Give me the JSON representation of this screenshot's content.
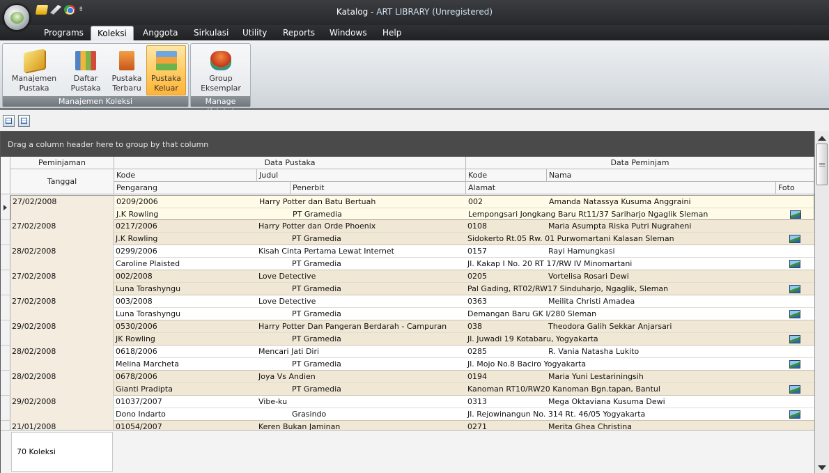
{
  "window": {
    "title_prefix": "Katalog - ",
    "title_app": "ART LIBRARY (Unregistered)"
  },
  "menu": [
    "Programs",
    "Koleksi",
    "Anggota",
    "Sirkulasi",
    "Utility",
    "Reports",
    "Windows",
    "Help"
  ],
  "ribbon": {
    "group1": {
      "label": "Manajemen Koleksi",
      "buttons": [
        {
          "line1": "Manajemen",
          "line2": "Pustaka"
        },
        {
          "line1": "Daftar",
          "line2": "Pustaka"
        },
        {
          "line1": "Pustaka",
          "line2": "Terbaru"
        },
        {
          "line1": "Pustaka",
          "line2": "Keluar"
        }
      ]
    },
    "group2": {
      "label": "Manage Koleksi",
      "buttons": [
        {
          "line1": "Group",
          "line2": "Eksemplar"
        }
      ]
    }
  },
  "grid": {
    "group_hint": "Drag a column header here to group by that column",
    "bands": {
      "peminjaman": "Peminjaman",
      "data_pustaka": "Data Pustaka",
      "data_peminjam": "Data Peminjam"
    },
    "columns": {
      "tanggal": "Tanggal",
      "kode": "Kode",
      "judul": "Judul",
      "pengarang": "Pengarang",
      "penerbit": "Penerbit",
      "kode2": "Kode",
      "nama": "Nama",
      "alamat": "Alamat",
      "foto": "Foto"
    },
    "rows": [
      {
        "tanggal": "27/02/2008",
        "kode": "0209/2006",
        "judul": "Harry Potter dan Batu Bertuah",
        "kode2": "002",
        "nama": "Amanda Natassya Kusuma Anggraini",
        "pengarang": "J.K Rowling",
        "penerbit": "PT Gramedia",
        "alamat": "Lempongsari Jongkang Baru Rt11/37 Sariharjo Ngaglik Sleman"
      },
      {
        "tanggal": "27/02/2008",
        "kode": "0217/2006",
        "judul": "Harry Potter dan Orde Phoenix",
        "kode2": "0108",
        "nama": "Maria Asumpta Riska Putri Nugraheni",
        "pengarang": "J.K Rowling",
        "penerbit": "PT Gramedia",
        "alamat": "Sidokerto Rt.05 Rw. 01 Purwomartani Kalasan Sleman"
      },
      {
        "tanggal": "28/02/2008",
        "kode": "0299/2006",
        "judul": "Kisah Cinta Pertama Lewat Internet",
        "kode2": "0157",
        "nama": "Rayi Hamungkasi",
        "pengarang": "Caroline Plaisted",
        "penerbit": "PT Gramedia",
        "alamat": "Jl. Kakap I No. 20 RT 17/RW IV Minomartani"
      },
      {
        "tanggal": "27/02/2008",
        "kode": "002/2008",
        "judul": "Love Detective",
        "kode2": "0205",
        "nama": "Vortelisa Rosari Dewi",
        "pengarang": "Luna Torashyngu",
        "penerbit": "PT Gramedia",
        "alamat": "Pal Gading, RT02/RW17 Sinduharjo, Ngaglik, Sleman"
      },
      {
        "tanggal": "27/02/2008",
        "kode": "003/2008",
        "judul": "Love Detective",
        "kode2": "0363",
        "nama": "Meilita Christi Amadea",
        "pengarang": "Luna Torashyngu",
        "penerbit": "PT Gramedia",
        "alamat": "Demangan Baru GK I/280 Sleman"
      },
      {
        "tanggal": "29/02/2008",
        "kode": "0530/2006",
        "judul": "Harry Potter Dan Pangeran Berdarah - Campuran",
        "kode2": "038",
        "nama": "Theodora Galih Sekkar Anjarsari",
        "pengarang": "JK Rowling",
        "penerbit": "PT Gramedia",
        "alamat": "Jl. Juwadi 19 Kotabaru, Yogyakarta"
      },
      {
        "tanggal": "28/02/2008",
        "kode": "0618/2006",
        "judul": "Mencari Jati Diri",
        "kode2": "0285",
        "nama": "R. Vania Natasha Lukito",
        "pengarang": "Melina Marcheta",
        "penerbit": "PT Gramedia",
        "alamat": "Jl. Mojo No.8 Baciro Yogyakarta"
      },
      {
        "tanggal": "28/02/2008",
        "kode": "0678/2006",
        "judul": "Joya Vs Andien",
        "kode2": "0194",
        "nama": "Maria Yuni Lestariningsih",
        "pengarang": "Gianti Pradipta",
        "penerbit": "PT Gramedia",
        "alamat": "Kanoman RT10/RW20 Kanoman Bgn.tapan, Bantul"
      },
      {
        "tanggal": "29/02/2008",
        "kode": "01037/2007",
        "judul": "Vibe-ku",
        "kode2": "0313",
        "nama": "Mega Oktaviana Kusuma Dewi",
        "pengarang": "Dono Indarto",
        "penerbit": "Grasindo",
        "alamat": "Jl. Rejowinangun No. 314 Rt. 46/05 Yogyakarta"
      },
      {
        "tanggal": "21/01/2008",
        "kode": "01054/2007",
        "judul": "Keren Bukan Jaminan",
        "kode2": "0271",
        "nama": "Merita Ghea Christina",
        "pengarang": "",
        "penerbit": "",
        "alamat": ""
      }
    ],
    "footer": "70 Koleksi"
  }
}
